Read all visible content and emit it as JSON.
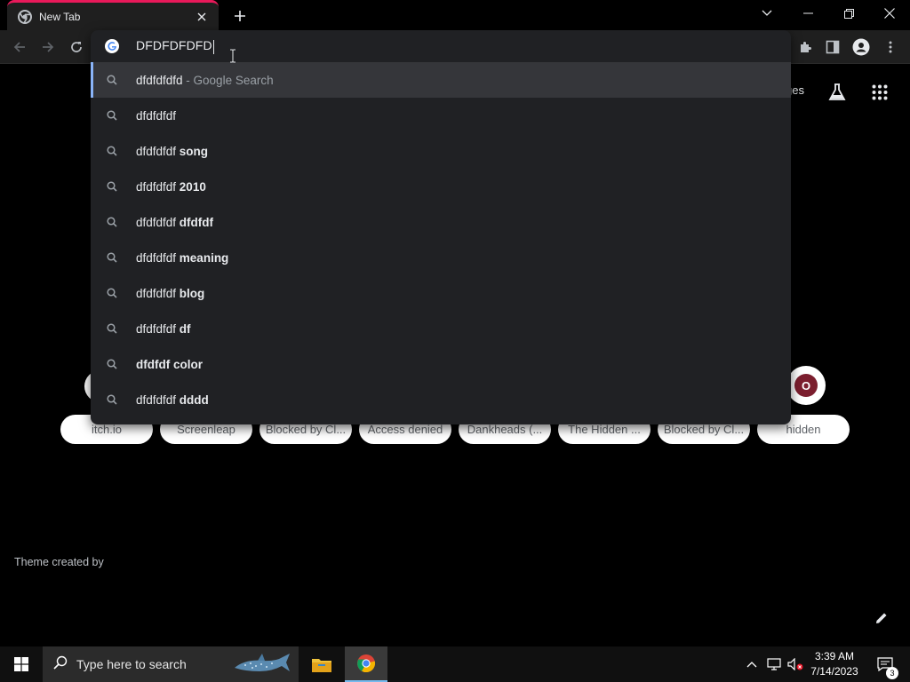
{
  "browser": {
    "tab": {
      "title": "New Tab"
    },
    "omnibox": {
      "typed_text": "DFDFDFDFD",
      "suggestions": [
        {
          "main": "dfdfdfdfd",
          "bold": "",
          "suffix": " - Google Search"
        },
        {
          "main": "dfdfdfdf",
          "bold": "",
          "suffix": ""
        },
        {
          "main": "dfdfdfdf ",
          "bold": "song",
          "suffix": ""
        },
        {
          "main": "dfdfdfdf ",
          "bold": "2010",
          "suffix": ""
        },
        {
          "main": "dfdfdfdf ",
          "bold": "dfdfdf",
          "suffix": ""
        },
        {
          "main": "dfdfdfdf ",
          "bold": "meaning",
          "suffix": ""
        },
        {
          "main": "dfdfdfdf ",
          "bold": "blog",
          "suffix": ""
        },
        {
          "main": "dfdfdfdf ",
          "bold": "df",
          "suffix": ""
        },
        {
          "main": "",
          "bold": "dfdfdf color",
          "suffix": ""
        },
        {
          "main": "dfdfdfdf ",
          "bold": "dddd",
          "suffix": ""
        }
      ]
    },
    "accent_colors": {
      "tab_accent": "#e8195a",
      "selection_bar": "#8ab4f8"
    }
  },
  "ntp": {
    "images_link": "ges",
    "shortcut_avatar_letter": "O",
    "shortcuts": [
      "itch.io",
      "Screenleap",
      "Blocked by Cl...",
      "Access denied",
      "Dankheads (...",
      "The Hidden ...",
      "Blocked by Cl...",
      "hidden"
    ],
    "theme_credit": "Theme created by"
  },
  "taskbar": {
    "search_placeholder": "Type here to search",
    "time": "3:39 AM",
    "date": "7/14/2023",
    "notification_count": "3"
  },
  "icons": {
    "tab": [
      "chrome-icon",
      "close-icon",
      "plus-icon"
    ],
    "window": [
      "tab-search-icon",
      "minimize-icon",
      "restore-icon",
      "close-icon"
    ],
    "toolbar": [
      "back-icon",
      "forward-icon",
      "reload-icon",
      "extensions-icon",
      "side-panel-icon",
      "profile-icon",
      "menu-icon"
    ],
    "ntp": [
      "labs-flask-icon",
      "apps-grid-icon",
      "pencil-icon"
    ],
    "taskbar": [
      "windows-start-icon",
      "search-icon",
      "file-explorer-icon",
      "chrome-icon",
      "chevron-up-icon",
      "network-icon",
      "volume-muted-icon",
      "notifications-icon"
    ]
  }
}
